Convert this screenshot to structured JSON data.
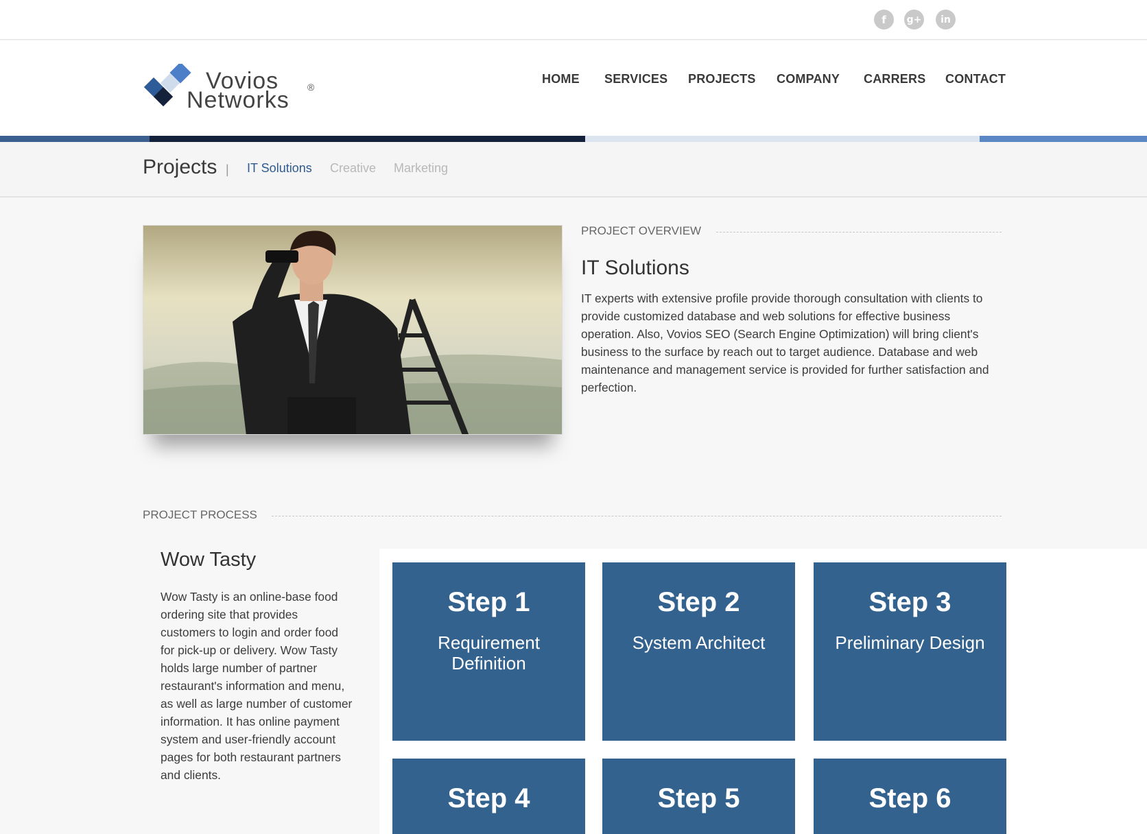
{
  "social": [
    {
      "name": "facebook",
      "glyph": "f"
    },
    {
      "name": "google-plus",
      "glyph": "g+"
    },
    {
      "name": "linkedin",
      "glyph": "in"
    }
  ],
  "logo": {
    "line1": "Vovios",
    "line2": "Networks",
    "reg": "®"
  },
  "nav": [
    "HOME",
    "SERVICES",
    "PROJECTS",
    "COMPANY",
    "CARRERS",
    "CONTACT"
  ],
  "subnav": {
    "title": "Projects",
    "tabs": [
      "IT Solutions",
      "Creative",
      "Marketing"
    ],
    "active": "IT Solutions"
  },
  "overview": {
    "label": "PROJECT OVERVIEW",
    "title": "IT Solutions",
    "text": "IT experts with extensive profile provide thorough consultation with clients to provide customized database and web solutions for effective business operation. Also, Vovios SEO (Search Engine Optimization) will bring client's business to the surface by reach out to target audience. Database and web maintenance and management service is provided for further satisfaction and perfection."
  },
  "process": {
    "label": "PROJECT PROCESS",
    "title": "Wow Tasty",
    "text": "Wow Tasty is an online-base food ordering site that provides customers to login and order food for pick-up or delivery. Wow Tasty holds large number of partner restaurant's information and menu, as well as large number of customer information. It has online payment system and user-friendly account pages for both restaurant partners and clients.",
    "steps": [
      {
        "num": "Step 1",
        "desc": "Requirement Definition"
      },
      {
        "num": "Step 2",
        "desc": "System Architect"
      },
      {
        "num": "Step 3",
        "desc": "Preliminary Design"
      },
      {
        "num": "Step 4",
        "desc": ""
      },
      {
        "num": "Step 5",
        "desc": ""
      },
      {
        "num": "Step 6",
        "desc": ""
      }
    ]
  },
  "colors": {
    "step_bg": "#34628f",
    "active_tab": "#2f5a8e",
    "brand_dark": "#13213a",
    "brand_light": "#5c87c5"
  }
}
